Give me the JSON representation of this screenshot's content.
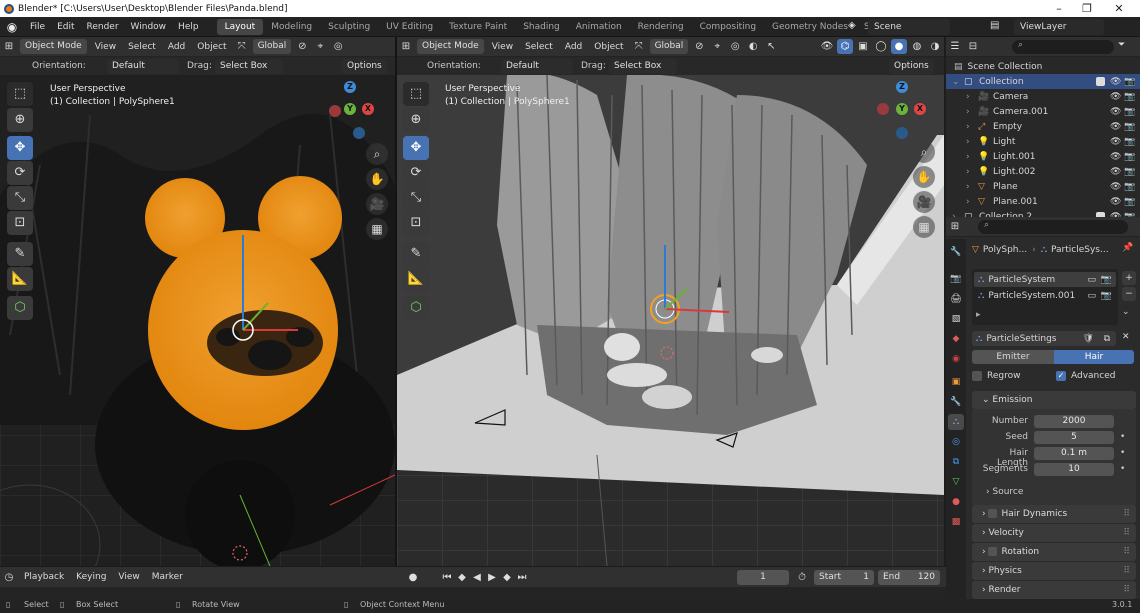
{
  "window": {
    "title": "Blender* [C:\\Users\\User\\Desktop\\Blender Files\\Panda.blend]",
    "min": "–",
    "max": "❐",
    "close": "✕"
  },
  "menu": [
    "File",
    "Edit",
    "Render",
    "Window",
    "Help"
  ],
  "workspaces": [
    "Layout",
    "Modeling",
    "Sculpting",
    "UV Editing",
    "Texture Paint",
    "Shading",
    "Animation",
    "Rendering",
    "Compositing",
    "Geometry Nodes",
    "Scripting"
  ],
  "add_workspace": "+",
  "scene": "Scene",
  "view_layer": "ViewLayer",
  "viewport_left": {
    "mode": "Object Mode",
    "menus": [
      "View",
      "Select",
      "Add",
      "Object"
    ],
    "transform": "Global",
    "orientation_label": "Orientation:",
    "orientation": "Default",
    "drag_label": "Drag:",
    "drag": "Select Box",
    "options": "Options",
    "perspective": "User Perspective",
    "collection": "(1) Collection | PolySphere1"
  },
  "viewport_right": {
    "mode": "Object Mode",
    "menus": [
      "View",
      "Select",
      "Add",
      "Object"
    ],
    "transform": "Global",
    "orientation_label": "Orientation:",
    "orientation": "Default",
    "drag_label": "Drag:",
    "drag": "Select Box",
    "options": "Options",
    "perspective": "User Perspective",
    "collection": "(1) Collection | PolySphere1"
  },
  "gizmo": {
    "x": "X",
    "y": "Y",
    "z": "Z"
  },
  "outliner": {
    "scene_collection": "Scene Collection",
    "items": [
      {
        "name": "Collection",
        "icon": "collection-icon"
      },
      {
        "name": "Camera",
        "icon": "camera-icon"
      },
      {
        "name": "Camera.001",
        "icon": "camera-icon"
      },
      {
        "name": "Empty",
        "icon": "empty-icon"
      },
      {
        "name": "Light",
        "icon": "light-icon"
      },
      {
        "name": "Light.001",
        "icon": "light-icon"
      },
      {
        "name": "Light.002",
        "icon": "light-icon"
      },
      {
        "name": "Plane",
        "icon": "mesh-icon"
      },
      {
        "name": "Plane.001",
        "icon": "mesh-icon"
      },
      {
        "name": "Collection 2",
        "icon": "collection-icon"
      }
    ]
  },
  "properties": {
    "breadcrumb_object": "PolySph...",
    "breadcrumb_system": "ParticleSys...",
    "systems": [
      "ParticleSystem",
      "ParticleSystem.001"
    ],
    "settings_name": "ParticleSettings",
    "type_emitter": "Emitter",
    "type_hair": "Hair",
    "regrow": "Regrow",
    "advanced": "Advanced",
    "emission": "Emission",
    "fields": [
      {
        "label": "Number",
        "value": "2000"
      },
      {
        "label": "Seed",
        "value": "5"
      },
      {
        "label": "Hair Length",
        "value": "0.1 m"
      },
      {
        "label": "Segments",
        "value": "10"
      }
    ],
    "source": "Source",
    "panels": [
      "Hair Dynamics",
      "Velocity",
      "Rotation",
      "Physics",
      "Render"
    ]
  },
  "timeline": {
    "playback": "Playback",
    "keying": "Keying",
    "view": "View",
    "marker": "Marker",
    "current_frame": "1",
    "start_label": "Start",
    "start": "1",
    "end_label": "End",
    "end": "120"
  },
  "status": {
    "select": "Select",
    "box_select": "Box Select",
    "rotate_view": "Rotate View",
    "context_menu": "Object Context Menu",
    "version": "3.0.1"
  },
  "colors": {
    "accent": "#4772b3",
    "selected": "#e88a10",
    "active_object": "#f5a11f"
  }
}
